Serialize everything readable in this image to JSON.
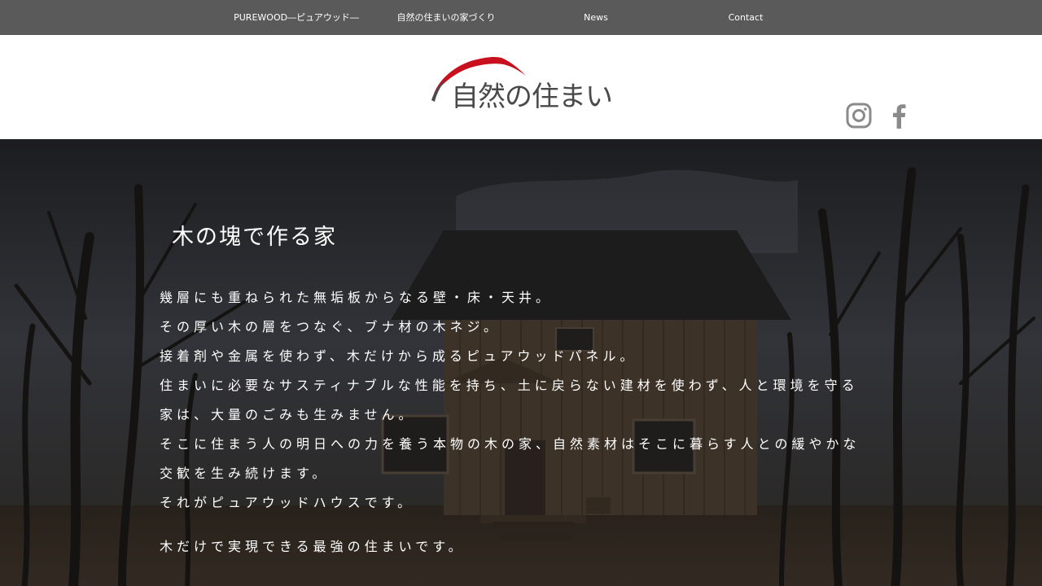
{
  "nav": {
    "items": [
      {
        "label": "PUREWOOD―ピュアウッド―"
      },
      {
        "label": "自然の住まいの家づくり"
      },
      {
        "label": "News"
      },
      {
        "label": "Contact"
      }
    ]
  },
  "header": {
    "logo_text": "自然の住まい",
    "social": [
      {
        "icon": "instagram-icon"
      },
      {
        "icon": "facebook-icon"
      }
    ]
  },
  "hero": {
    "title": "木の塊で作る家",
    "lines": [
      "幾層にも重ねられた無垢板からなる壁・床・天井。",
      "その厚い木の層をつなぐ、ブナ材の木ネジ。",
      "接着剤や金属を使わず、木だけから成るピュアウッドパネル。",
      "住まいに必要なサスティナブルな性能を持ち、土に戻らない建材を使わず、人と環境を守る",
      "家は、大量のごみも生みません。",
      "そこに住まう人の明日への力を養う本物の木の家、自然素材はそこに暮らす人との緩やかな",
      "交歓を生み続けます。",
      "それがピュアウッドハウスです。"
    ],
    "closing": "木だけで実現できる最強の住まいです。"
  },
  "colors": {
    "nav_bg": "#5a5a5a",
    "logo_accent": "#c8101e",
    "logo_text": "#4a4a4a",
    "social_icon": "#8a8a8a"
  }
}
